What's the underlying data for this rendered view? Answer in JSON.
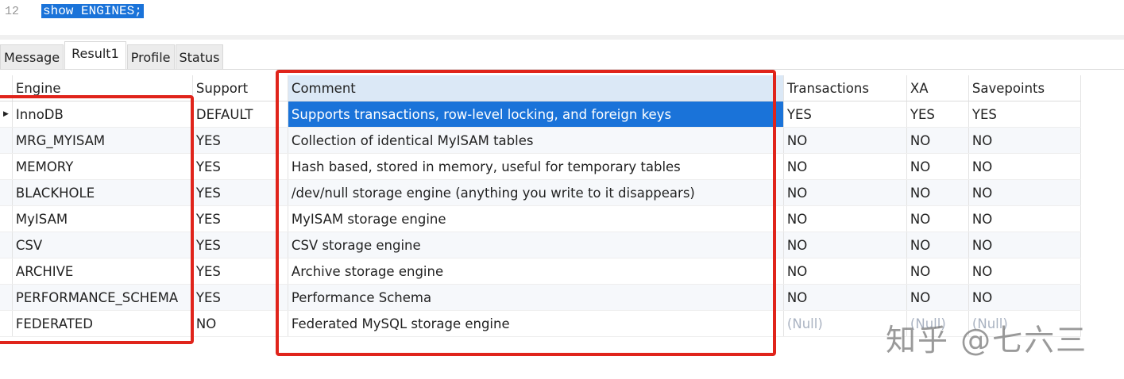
{
  "editor": {
    "line_number": "12",
    "code": "show ENGINES;"
  },
  "tabs": [
    "Message",
    "Result1",
    "Profile",
    "Status"
  ],
  "columns": [
    "Engine",
    "Support",
    "Comment",
    "Transactions",
    "XA",
    "Savepoints"
  ],
  "rows": [
    [
      "InnoDB",
      "DEFAULT",
      "Supports transactions, row-level locking, and foreign keys",
      "YES",
      "YES",
      "YES"
    ],
    [
      "MRG_MYISAM",
      "YES",
      "Collection of identical MyISAM tables",
      "NO",
      "NO",
      "NO"
    ],
    [
      "MEMORY",
      "YES",
      "Hash based, stored in memory, useful for temporary tables",
      "NO",
      "NO",
      "NO"
    ],
    [
      "BLACKHOLE",
      "YES",
      "/dev/null storage engine (anything you write to it disappears)",
      "NO",
      "NO",
      "NO"
    ],
    [
      "MyISAM",
      "YES",
      "MyISAM storage engine",
      "NO",
      "NO",
      "NO"
    ],
    [
      "CSV",
      "YES",
      "CSV storage engine",
      "NO",
      "NO",
      "NO"
    ],
    [
      "ARCHIVE",
      "YES",
      "Archive storage engine",
      "NO",
      "NO",
      "NO"
    ],
    [
      "PERFORMANCE_SCHEMA",
      "YES",
      "Performance Schema",
      "NO",
      "NO",
      "NO"
    ],
    [
      "FEDERATED",
      "NO",
      "Federated MySQL storage engine",
      "(Null)",
      "(Null)",
      "(Null)"
    ]
  ],
  "watermark": "知乎 @七六三",
  "colors": {
    "highlight": "#e0241b",
    "selection": "#1a73d9"
  }
}
